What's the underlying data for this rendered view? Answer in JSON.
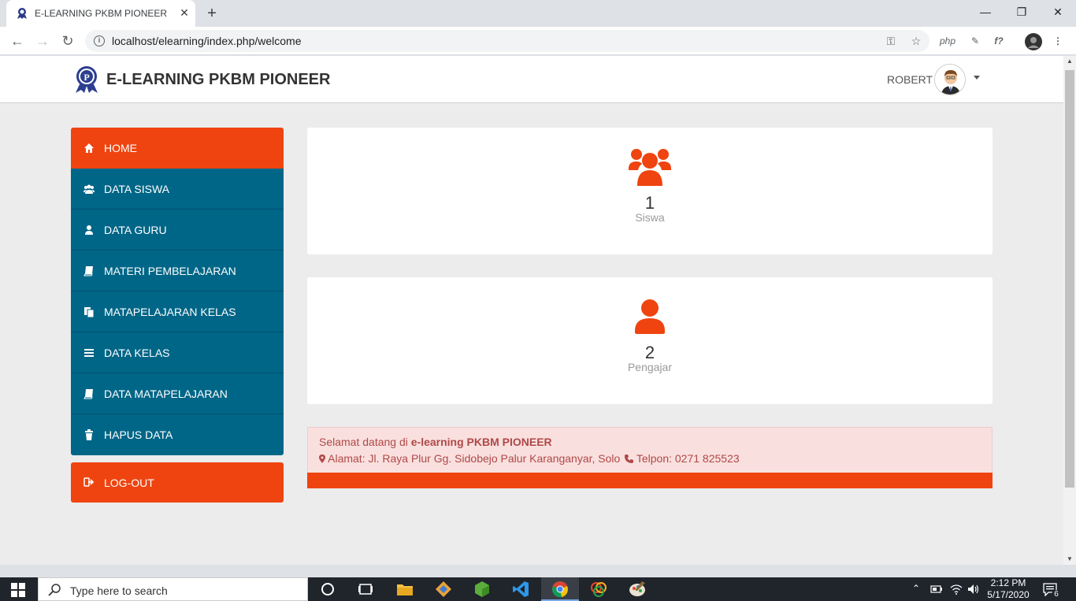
{
  "browser": {
    "tab_title": "E-LEARNING PKBM PIONEER",
    "tab_close": "✕",
    "new_tab": "+",
    "url": "localhost/elearning/index.php/welcome",
    "minimize": "—",
    "maximize": "❐",
    "close": "✕",
    "ext_php": "php",
    "ext_fx": "f?"
  },
  "header": {
    "brand": "E-LEARNING PKBM PIONEER",
    "user_name": "ROBERT"
  },
  "sidebar": {
    "items": [
      {
        "label": "HOME",
        "icon": "home-icon",
        "active": true
      },
      {
        "label": "DATA SISWA",
        "icon": "users-icon"
      },
      {
        "label": "DATA GURU",
        "icon": "user-icon"
      },
      {
        "label": "MATERI PEMBELAJARAN",
        "icon": "book-icon"
      },
      {
        "label": "MATAPELAJARAN KELAS",
        "icon": "files-icon"
      },
      {
        "label": "DATA KELAS",
        "icon": "list-icon"
      },
      {
        "label": "DATA MATAPELAJARAN",
        "icon": "book-icon"
      },
      {
        "label": "HAPUS DATA",
        "icon": "trash-icon"
      }
    ],
    "logout_label": "LOG-OUT"
  },
  "stats": {
    "siswa_count": "1",
    "siswa_label": "Siswa",
    "pengajar_count": "2",
    "pengajar_label": "Pengajar"
  },
  "alert": {
    "greeting": "Selamat datang di ",
    "site_name": "e-learning PKBM PIONEER",
    "address": "Alamat: Jl. Raya Plur Gg. Sidobejo Palur Karanganyar, Solo",
    "phone": "Telpon: 0271 825523"
  },
  "taskbar": {
    "search_placeholder": "Type here to search",
    "time": "2:12 PM",
    "date": "5/17/2020",
    "notifications": "6"
  },
  "colors": {
    "accent": "#ef4410",
    "sidebar": "#006687"
  }
}
